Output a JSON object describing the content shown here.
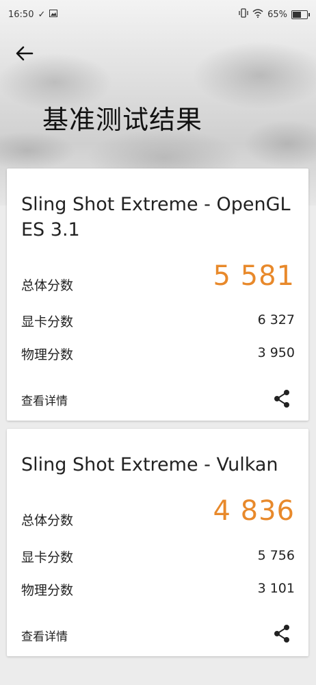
{
  "status": {
    "time": "16:50",
    "battery": "65%"
  },
  "header": {
    "title": "基准测试结果"
  },
  "results": [
    {
      "title": "Sling Shot Extreme - OpenGL ES 3.1",
      "total_label": "总体分数",
      "total_value": "5 581",
      "graphics_label": "显卡分数",
      "graphics_value": "6 327",
      "physics_label": "物理分数",
      "physics_value": "3 950",
      "details_label": "查看详情"
    },
    {
      "title": "Sling Shot Extreme - Vulkan",
      "total_label": "总体分数",
      "total_value": "4 836",
      "graphics_label": "显卡分数",
      "graphics_value": "5 756",
      "physics_label": "物理分数",
      "physics_value": "3 101",
      "details_label": "查看详情"
    }
  ],
  "colors": {
    "accent": "#e8892b"
  },
  "icons": {
    "back": "arrow-left-icon",
    "share": "share-icon"
  }
}
